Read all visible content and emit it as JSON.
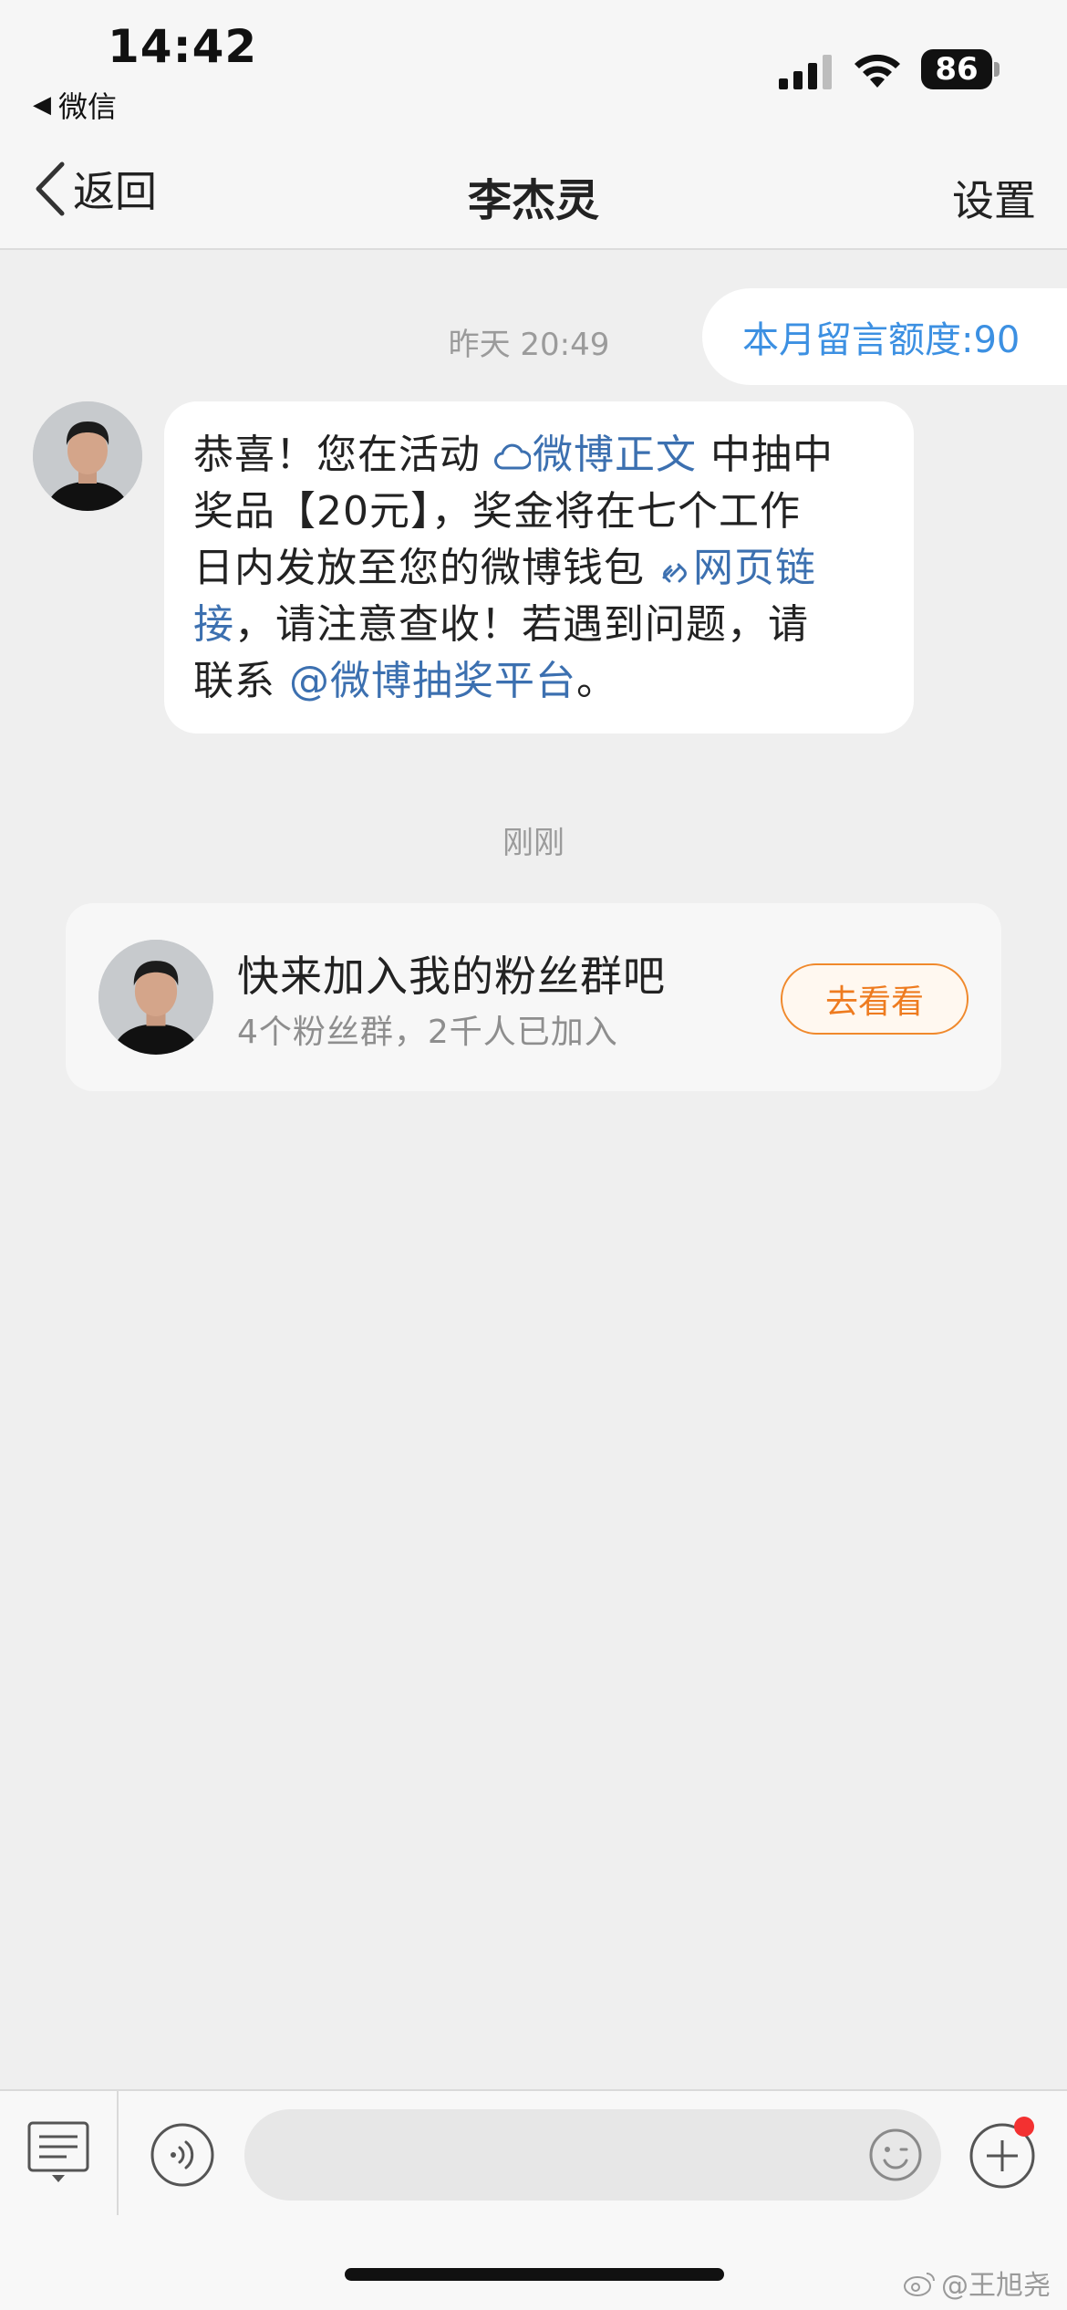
{
  "status_bar": {
    "time": "14:42",
    "back_app": "微信",
    "battery": "86"
  },
  "nav": {
    "back_label": "返回",
    "title": "李杰灵",
    "settings_label": "设置"
  },
  "chat": {
    "quota_text": "本月留言额度:90",
    "timestamp_1": "昨天 20:49",
    "message": {
      "l1_a": "恭喜！您在活动 ",
      "link_weibo_post": "微博正文",
      "l1_b": " 中抽中",
      "l2": "奖品【20元】，奖金将在七个工作",
      "l3_a": "日内发放至您的微博钱包 ",
      "link_web_a": "网页链",
      "link_web_b": "接",
      "l4_b": "，请注意查收！若遇到问题，请",
      "l5_a": "联系 ",
      "link_lottery": "@微博抽奖平台",
      "l5_b": "。"
    },
    "timestamp_2": "刚刚",
    "fan_card": {
      "title": "快来加入我的粉丝群吧",
      "subtitle": "4个粉丝群，2千人已加入",
      "button": "去看看"
    }
  },
  "input": {
    "placeholder": ""
  },
  "watermark": "@王旭尧",
  "colors": {
    "link": "#3c70b0",
    "quota": "#3c90e2",
    "accent_orange": "#ee7b1f",
    "badge_red": "#f33131"
  }
}
